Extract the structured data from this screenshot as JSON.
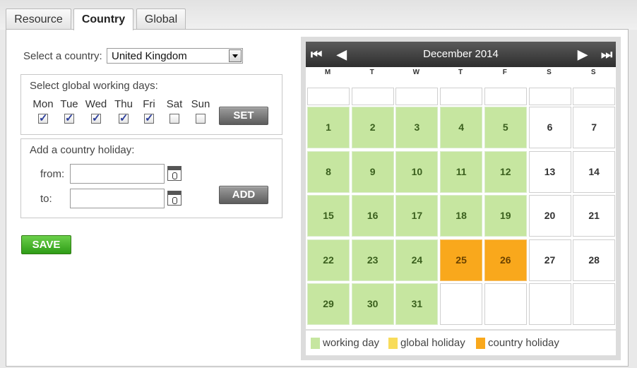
{
  "tabs": [
    "Resource",
    "Country",
    "Global"
  ],
  "country": {
    "label": "Select a country:",
    "selected": "United Kingdom"
  },
  "working_days": {
    "title": "Select global working days:",
    "days": [
      {
        "label": "Mon",
        "checked": true
      },
      {
        "label": "Tue",
        "checked": true
      },
      {
        "label": "Wed",
        "checked": true
      },
      {
        "label": "Thu",
        "checked": true
      },
      {
        "label": "Fri",
        "checked": true
      },
      {
        "label": "Sat",
        "checked": false
      },
      {
        "label": "Sun",
        "checked": false
      }
    ],
    "set_label": "SET"
  },
  "holiday": {
    "title": "Add a country holiday:",
    "from_label": "from:",
    "to_label": "to:",
    "from_value": "",
    "to_value": "",
    "add_label": "ADD",
    "from_icon": "calendar-icon",
    "to_icon": "calendar-icon"
  },
  "save_label": "SAVE",
  "calendar": {
    "month_title": "December 2014",
    "nav": {
      "first": "⏮",
      "prev": "◀",
      "next": "▶",
      "last": "⏭"
    },
    "weekdays": [
      "M",
      "T",
      "W",
      "T",
      "F",
      "S",
      "S"
    ],
    "weeks": [
      [
        {
          "d": "1",
          "t": "work"
        },
        {
          "d": "2",
          "t": "work"
        },
        {
          "d": "3",
          "t": "work"
        },
        {
          "d": "4",
          "t": "work"
        },
        {
          "d": "5",
          "t": "work"
        },
        {
          "d": "6",
          "t": "none"
        },
        {
          "d": "7",
          "t": "none"
        }
      ],
      [
        {
          "d": "8",
          "t": "work"
        },
        {
          "d": "9",
          "t": "work"
        },
        {
          "d": "10",
          "t": "work"
        },
        {
          "d": "11",
          "t": "work"
        },
        {
          "d": "12",
          "t": "work"
        },
        {
          "d": "13",
          "t": "none"
        },
        {
          "d": "14",
          "t": "none"
        }
      ],
      [
        {
          "d": "15",
          "t": "work"
        },
        {
          "d": "16",
          "t": "work"
        },
        {
          "d": "17",
          "t": "work"
        },
        {
          "d": "18",
          "t": "work"
        },
        {
          "d": "19",
          "t": "work"
        },
        {
          "d": "20",
          "t": "none"
        },
        {
          "d": "21",
          "t": "none"
        }
      ],
      [
        {
          "d": "22",
          "t": "work"
        },
        {
          "d": "23",
          "t": "work"
        },
        {
          "d": "24",
          "t": "work"
        },
        {
          "d": "25",
          "t": "country"
        },
        {
          "d": "26",
          "t": "country"
        },
        {
          "d": "27",
          "t": "none"
        },
        {
          "d": "28",
          "t": "none"
        }
      ],
      [
        {
          "d": "29",
          "t": "work"
        },
        {
          "d": "30",
          "t": "work"
        },
        {
          "d": "31",
          "t": "work"
        },
        {
          "d": "",
          "t": "empty"
        },
        {
          "d": "",
          "t": "empty"
        },
        {
          "d": "",
          "t": "empty"
        },
        {
          "d": "",
          "t": "empty"
        }
      ]
    ],
    "legend": [
      {
        "label": "working day",
        "color": "#c6e6a0"
      },
      {
        "label": "global holiday",
        "color": "#f8dc5a"
      },
      {
        "label": "country holiday",
        "color": "#f9a81c"
      }
    ]
  }
}
